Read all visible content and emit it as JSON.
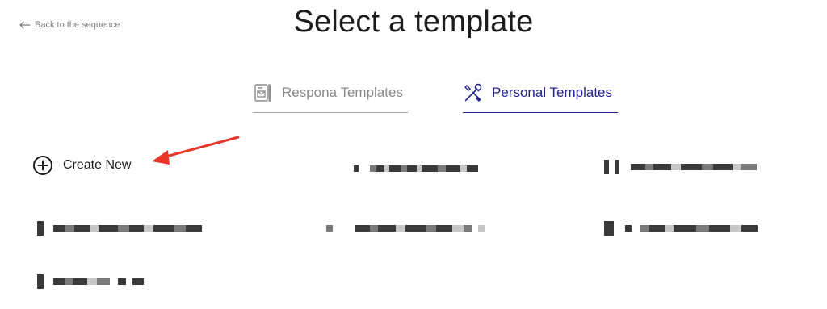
{
  "back_link": {
    "label": "Back to the sequence"
  },
  "page_title": "Select a template",
  "tabs": [
    {
      "label": "Respona Templates",
      "icon": "template-doc-icon",
      "active": false
    },
    {
      "label": "Personal Templates",
      "icon": "tools-icon",
      "active": true
    }
  ],
  "create_new": {
    "label": "Create New",
    "icon": "plus-circle-icon"
  },
  "colors": {
    "accent": "#25238e",
    "annotation_arrow": "#e8352a"
  }
}
